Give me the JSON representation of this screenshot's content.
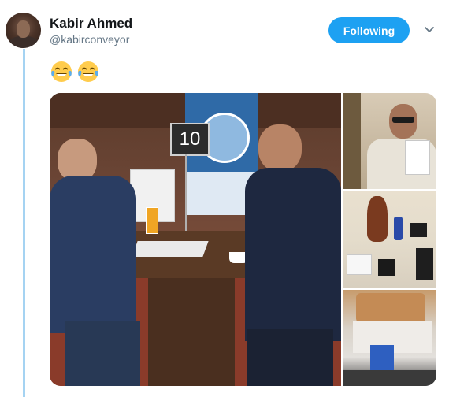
{
  "user": {
    "name": "Kabir Ahmed",
    "handle": "@kabirconveyor"
  },
  "follow_button": {
    "label": "Following"
  },
  "tweet": {
    "emojis": [
      "face-with-tears-of-joy",
      "face-with-tears-of-joy"
    ]
  },
  "media": {
    "main_photo_table_sign": "10",
    "images": [
      {
        "name": "business-meeting-photo"
      },
      {
        "name": "man-holding-brochure-photo"
      },
      {
        "name": "hotel-desk-photo"
      },
      {
        "name": "hotel-bed-photo"
      }
    ]
  },
  "colors": {
    "accent": "#1da1f2",
    "thread_line": "#a5d3f2",
    "name_text": "#14171a",
    "handle_text": "#657786"
  }
}
